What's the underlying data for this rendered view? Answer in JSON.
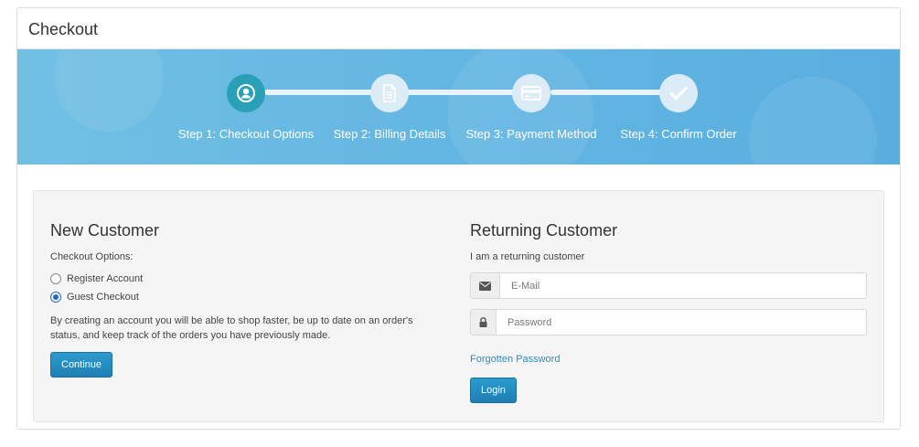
{
  "page": {
    "title": "Checkout"
  },
  "steps": [
    {
      "label": "Step 1: Checkout Options",
      "icon": "user-icon",
      "active": true
    },
    {
      "label": "Step 2: Billing Details",
      "icon": "document-icon",
      "active": false
    },
    {
      "label": "Step 3: Payment Method",
      "icon": "credit-card-icon",
      "active": false
    },
    {
      "label": "Step 4: Confirm Order",
      "icon": "check-icon",
      "active": false
    }
  ],
  "new_customer": {
    "heading": "New Customer",
    "options_label": "Checkout Options:",
    "options": [
      {
        "label": "Register Account",
        "checked": false
      },
      {
        "label": "Guest Checkout",
        "checked": true
      }
    ],
    "description": "By creating an account you will be able to shop faster, be up to date on an order's status, and keep track of the orders you have previously made.",
    "continue_label": "Continue"
  },
  "returning_customer": {
    "heading": "Returning Customer",
    "subtext": "I am a returning customer",
    "email_placeholder": "E-Mail",
    "password_placeholder": "Password",
    "forgot_label": "Forgotten Password",
    "login_label": "Login"
  },
  "colors": {
    "band": "#63b6e2",
    "active_step": "#2aa0b6",
    "button": "#2390c4",
    "link": "#2a8dc2"
  }
}
